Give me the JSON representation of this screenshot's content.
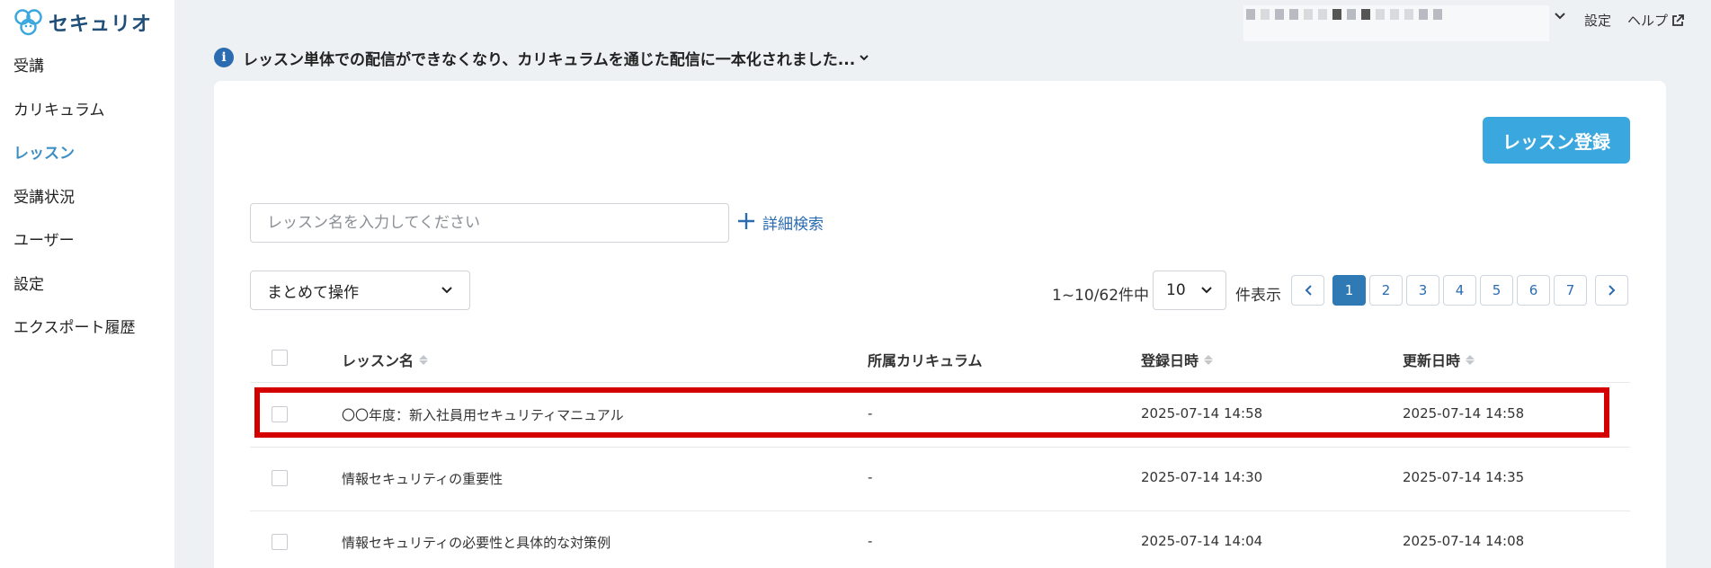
{
  "brand": {
    "name": "セキュリオ"
  },
  "sidebar": {
    "items": [
      {
        "label": "受講"
      },
      {
        "label": "カリキュラム"
      },
      {
        "label": "レッスン"
      },
      {
        "label": "受講状況"
      },
      {
        "label": "ユーザー"
      },
      {
        "label": "設定"
      },
      {
        "label": "エクスポート履歴"
      }
    ]
  },
  "header": {
    "settings_label": "設定",
    "help_label": "ヘルプ"
  },
  "notice": {
    "text": "レッスン単体での配信ができなくなり、カリキュラムを通じた配信に一本化されました..."
  },
  "main": {
    "register_button": "レッスン登録",
    "search_placeholder": "レッスン名を入力してください",
    "advanced_search": "詳細検索",
    "bulk_action": "まとめて操作",
    "count_text": "1~10/62件中",
    "per_page_value": "10",
    "per_page_suffix": "件表示",
    "pages": [
      "1",
      "2",
      "3",
      "4",
      "5",
      "6",
      "7"
    ],
    "current_page": "1"
  },
  "table": {
    "columns": [
      "レッスン名",
      "所属カリキュラム",
      "登録日時",
      "更新日時"
    ],
    "rows": [
      {
        "name": "〇〇年度：新入社員用セキュリティマニュアル",
        "curriculum": "-",
        "created": "2025-07-14 14:58",
        "updated": "2025-07-14 14:58"
      },
      {
        "name": "情報セキュリティの重要性",
        "curriculum": "-",
        "created": "2025-07-14 14:30",
        "updated": "2025-07-14 14:35"
      },
      {
        "name": "情報セキュリティの必要性と具体的な対策例",
        "curriculum": "-",
        "created": "2025-07-14 14:04",
        "updated": "2025-07-14 14:08"
      }
    ]
  },
  "colors": {
    "accent": "#3aa8de",
    "link": "#2b6cb0",
    "active_nav": "#3d8fc4",
    "highlight": "#d40000"
  }
}
